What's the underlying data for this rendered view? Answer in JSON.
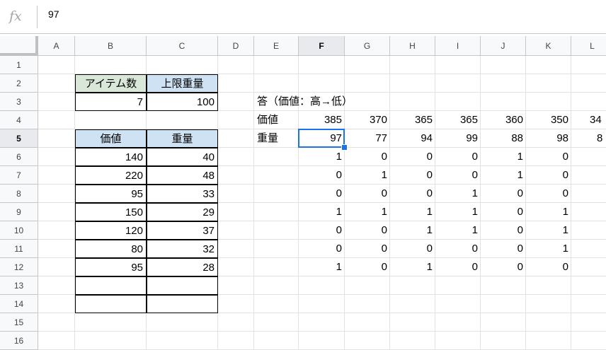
{
  "formula_bar": {
    "fx_label": "fx",
    "value": "97"
  },
  "columns": [
    "A",
    "B",
    "C",
    "D",
    "E",
    "F",
    "G",
    "H",
    "I",
    "J",
    "K",
    "L"
  ],
  "rows": [
    "1",
    "2",
    "3",
    "4",
    "5",
    "6",
    "7",
    "8",
    "9",
    "10",
    "11",
    "12",
    "13",
    "14",
    "15",
    "16"
  ],
  "params": {
    "item_count_label": "アイテム数",
    "capacity_label": "上限重量",
    "item_count": "7",
    "capacity": "100"
  },
  "items": {
    "value_header": "価値",
    "weight_header": "重量",
    "rows": [
      [
        "140",
        "40"
      ],
      [
        "220",
        "48"
      ],
      [
        "95",
        "33"
      ],
      [
        "150",
        "29"
      ],
      [
        "120",
        "37"
      ],
      [
        "80",
        "32"
      ],
      [
        "95",
        "28"
      ]
    ]
  },
  "answer": {
    "title": "答（価値：高→低）",
    "value_label": "価値",
    "weight_label": "重量",
    "values": [
      "385",
      "370",
      "365",
      "365",
      "360",
      "350",
      "34"
    ],
    "weights": [
      "97",
      "77",
      "94",
      "99",
      "88",
      "98",
      "8"
    ],
    "matrix": [
      [
        "1",
        "0",
        "0",
        "0",
        "1",
        "0"
      ],
      [
        "0",
        "1",
        "0",
        "0",
        "1",
        "0"
      ],
      [
        "0",
        "0",
        "0",
        "1",
        "0",
        "0"
      ],
      [
        "1",
        "1",
        "1",
        "1",
        "0",
        "1"
      ],
      [
        "0",
        "0",
        "1",
        "1",
        "0",
        "1"
      ],
      [
        "0",
        "0",
        "0",
        "0",
        "0",
        "1"
      ],
      [
        "1",
        "0",
        "1",
        "0",
        "0",
        "0"
      ]
    ]
  },
  "selection": {
    "cell": "F5"
  }
}
